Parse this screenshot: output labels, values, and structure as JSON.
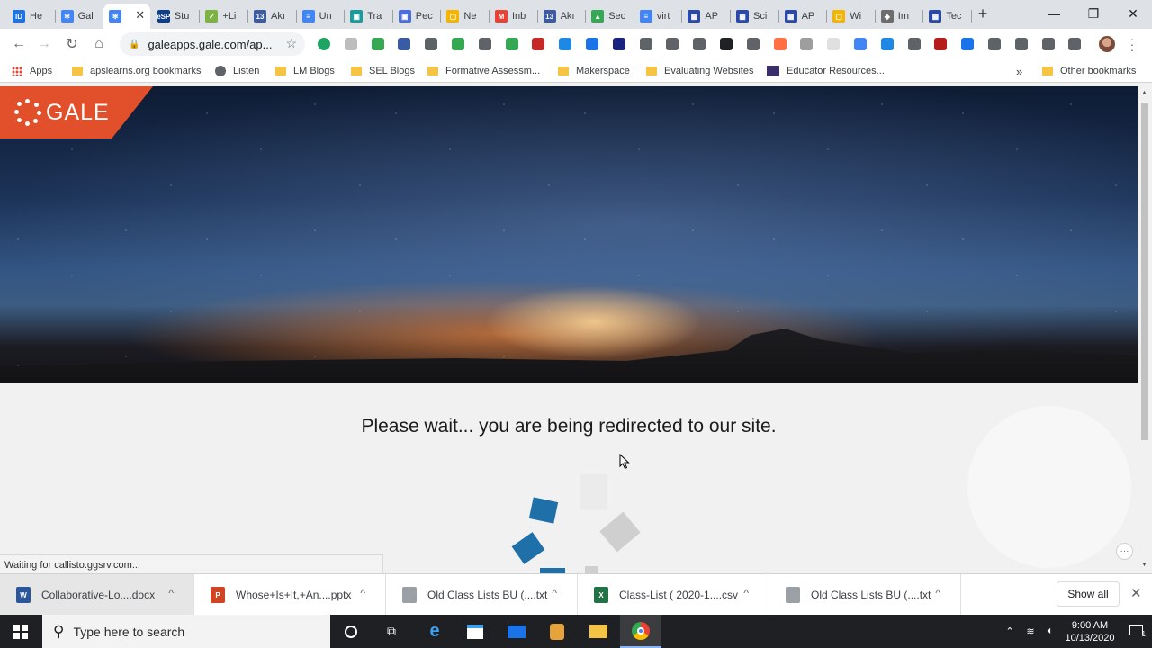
{
  "tabs": [
    {
      "title": "He",
      "color": "#1a73e8",
      "glyph": "ID"
    },
    {
      "title": "Gal",
      "color": "#4285f4",
      "glyph": "✻"
    },
    {
      "title": "",
      "color": "#4285f4",
      "glyph": "✻",
      "active": true
    },
    {
      "title": "Stu",
      "color": "#0d3f8f",
      "glyph": "eSP"
    },
    {
      "title": "+Li",
      "color": "#7cb342",
      "glyph": "✓"
    },
    {
      "title": "Akı",
      "color": "#3b5ba5",
      "glyph": "13"
    },
    {
      "title": "Un",
      "color": "#4285f4",
      "glyph": "≡"
    },
    {
      "title": "Tra",
      "color": "#1a9c9c",
      "glyph": "▣"
    },
    {
      "title": "Pec",
      "color": "#4a6ee0",
      "glyph": "▣"
    },
    {
      "title": "Ne",
      "color": "#f4b400",
      "glyph": "▢"
    },
    {
      "title": "Inb",
      "color": "#ea4335",
      "glyph": "M"
    },
    {
      "title": "Akı",
      "color": "#3b5ba5",
      "glyph": "13"
    },
    {
      "title": "Sec",
      "color": "#34a853",
      "glyph": "▲"
    },
    {
      "title": "virt",
      "color": "#4285f4",
      "glyph": "≡"
    },
    {
      "title": "AP",
      "color": "#2a4aa8",
      "glyph": "▦"
    },
    {
      "title": "Sci",
      "color": "#2a4aa8",
      "glyph": "▦"
    },
    {
      "title": "AP",
      "color": "#2a4aa8",
      "glyph": "▦"
    },
    {
      "title": "Wi",
      "color": "#f4b400",
      "glyph": "▢"
    },
    {
      "title": "Im",
      "color": "#6d6d6d",
      "glyph": "◆"
    },
    {
      "title": "Tec",
      "color": "#2a4aa8",
      "glyph": "▦"
    }
  ],
  "window_controls": {
    "minimize": "—",
    "restore": "❐",
    "close": "✕"
  },
  "new_tab_label": "+",
  "tab_close_glyph": "✕",
  "nav": {
    "back": "←",
    "forward": "→",
    "reload": "↻",
    "home": "⌂"
  },
  "address": {
    "lock": "🔒",
    "url": "galeapps.gale.com/ap...",
    "star": "☆"
  },
  "extension_colors": [
    "#1fa463",
    "#bdbdbd",
    "#34a853",
    "#3b5ba5",
    "#5f6368",
    "#34a853",
    "#5f6368",
    "#34a853",
    "#c62828",
    "#1e88e5",
    "#1a73e8",
    "#1a237e",
    "#5f6368",
    "#5f6368",
    "#5f6368",
    "#202124",
    "#5f6368",
    "#ff7043",
    "#9e9e9e",
    "#e0e0e0",
    "#4285f4",
    "#1e88e5",
    "#5f6368",
    "#b71c1c",
    "#1a73e8",
    "#5f6368",
    "#5f6368",
    "#5f6368",
    "#5f6368"
  ],
  "bookmarks": [
    {
      "label": "Apps",
      "icon": "apps-grid"
    },
    {
      "label": "apslearns.org bookmarks",
      "icon": "folder"
    },
    {
      "label": "Listen",
      "icon": "globe"
    },
    {
      "label": "LM Blogs",
      "icon": "folder"
    },
    {
      "label": "SEL Blogs",
      "icon": "folder"
    },
    {
      "label": "Formative Assessm...",
      "icon": "folder"
    },
    {
      "label": "Makerspace",
      "icon": "folder"
    },
    {
      "label": "Evaluating Websites",
      "icon": "folder"
    },
    {
      "label": "Educator Resources...",
      "icon": "cml-logo"
    }
  ],
  "bookmarks_overflow": "»",
  "other_bookmarks": "Other bookmarks",
  "brand": {
    "name": "GALE",
    "color": "#e24f2b"
  },
  "redirect_message": "Please wait... you are being redirected to our site.",
  "status_text": "Waiting for callisto.ggsrv.com...",
  "more_button": "···",
  "downloads": [
    {
      "name": "Collaborative-Lo....docx",
      "type": "word",
      "color": "#2b579a",
      "glyph": "W"
    },
    {
      "name": "Whose+Is+It,+An....pptx",
      "type": "powerpoint",
      "color": "#d04423",
      "glyph": "P"
    },
    {
      "name": "Old Class Lists BU (....txt",
      "type": "text",
      "color": "#9aa0a6",
      "glyph": ""
    },
    {
      "name": "Class-List ( 2020-1....csv",
      "type": "excel",
      "color": "#217346",
      "glyph": "X"
    },
    {
      "name": "Old Class Lists BU (....txt",
      "type": "text",
      "color": "#9aa0a6",
      "glyph": ""
    }
  ],
  "download_chevron": "^",
  "show_all_label": "Show all",
  "shelf_close": "✕",
  "taskbar": {
    "search_placeholder": "Type here to search",
    "time": "9:00 AM",
    "date": "10/13/2020",
    "notification_count": "1"
  }
}
